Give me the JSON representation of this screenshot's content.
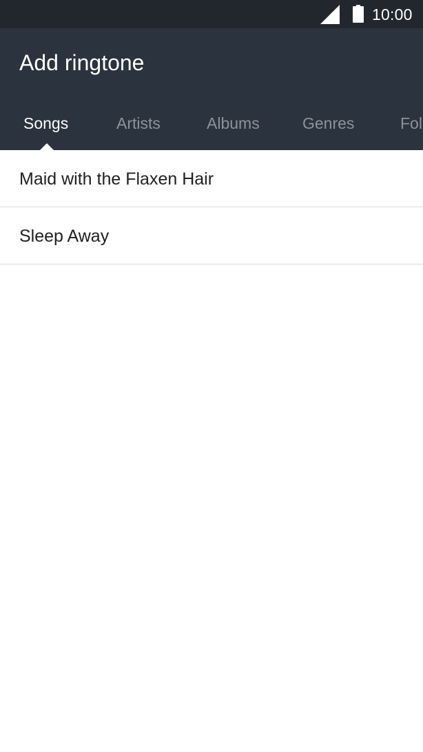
{
  "status_bar": {
    "time": "10:00",
    "icons": [
      "signal-icon",
      "battery-icon"
    ]
  },
  "app_bar": {
    "title": "Add ringtone"
  },
  "tabs": [
    {
      "label": "Songs",
      "active": true
    },
    {
      "label": "Artists",
      "active": false
    },
    {
      "label": "Albums",
      "active": false
    },
    {
      "label": "Genres",
      "active": false
    },
    {
      "label": "Folders",
      "active": false
    }
  ],
  "songs": [
    {
      "title": "Maid with the Flaxen Hair"
    },
    {
      "title": "Sleep Away"
    }
  ],
  "colors": {
    "status_bar_bg": "#22272e",
    "app_bar_bg": "#2b333e",
    "tab_active": "#ffffff",
    "tab_inactive": "#8d939a",
    "divider": "#dcdcdc"
  }
}
